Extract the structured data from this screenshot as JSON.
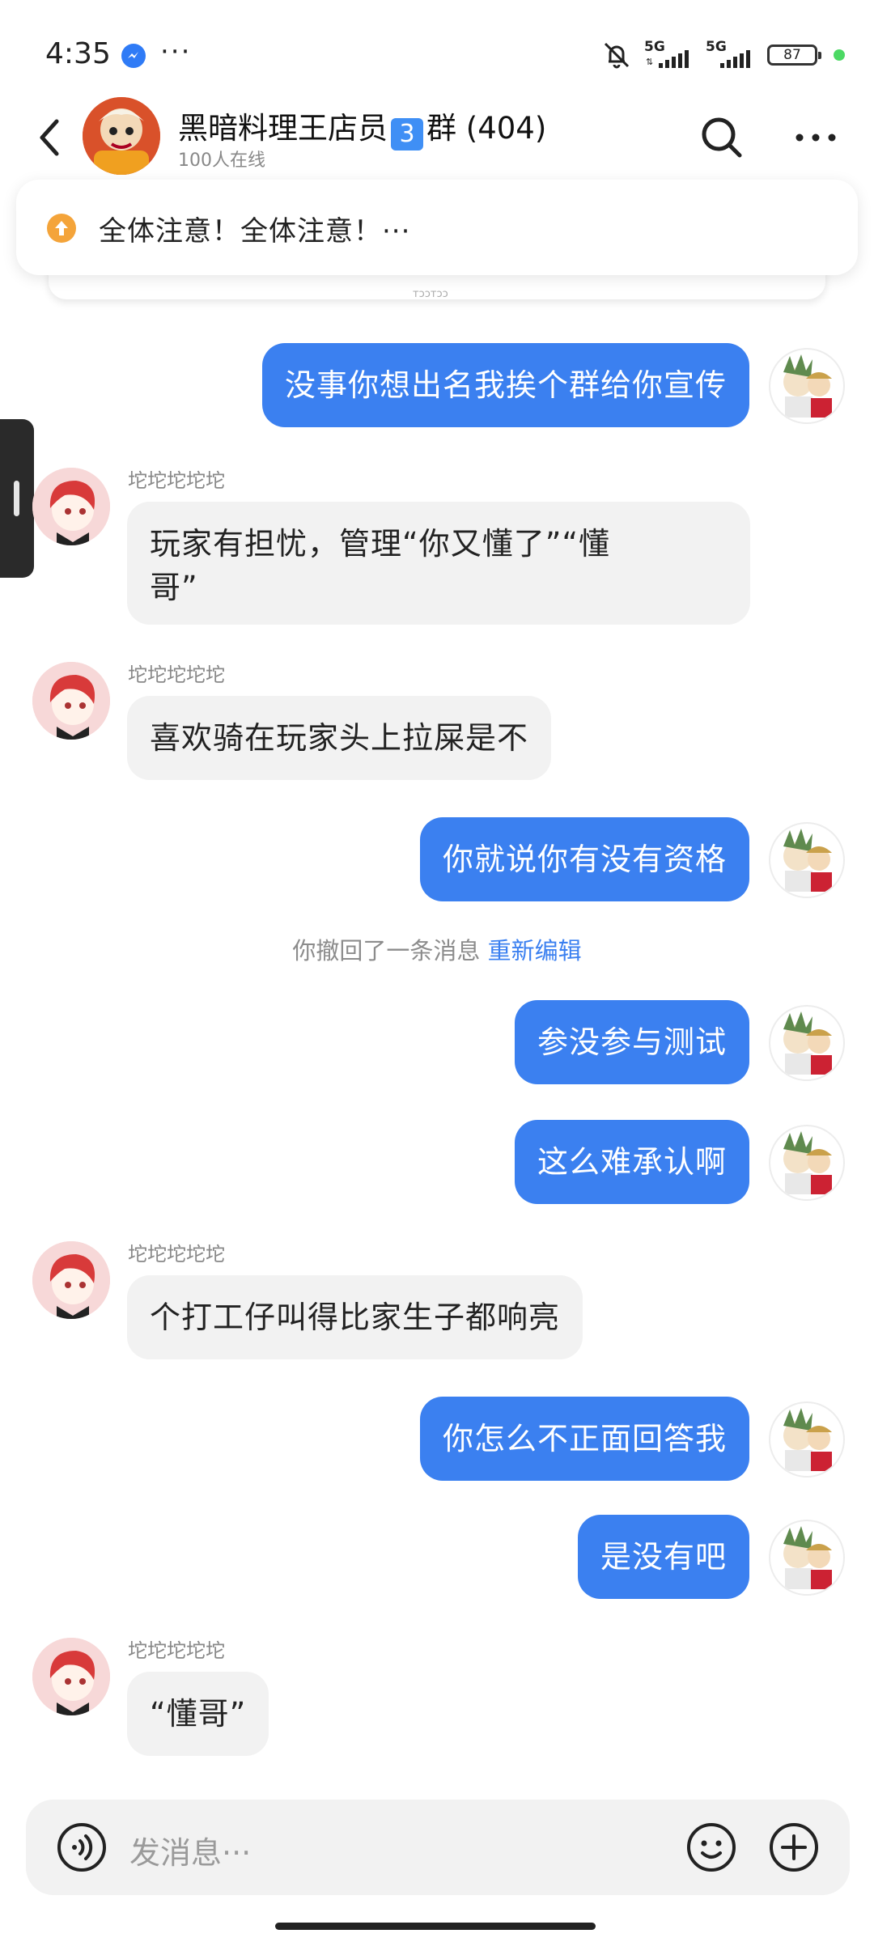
{
  "status_bar": {
    "time": "4:35",
    "more": "···",
    "net1": "5G",
    "net2": "5G",
    "battery": "87"
  },
  "header": {
    "title_prefix": "黑暗料理王店员",
    "title_badge": "3",
    "title_suffix": "群 (404)",
    "online": "100人在线"
  },
  "pinned": {
    "text": "全体注意！全体注意！···",
    "peek": "ᴛᴐᴐᴛᴐᴐ"
  },
  "messages": [
    {
      "side": "me",
      "text": "没事你想出名我挨个群给你宣传"
    },
    {
      "side": "other",
      "sender": "坨坨坨坨坨",
      "line1": "玩家有担忧，管理“你又懂了”“懂",
      "line2": "哥”"
    },
    {
      "side": "other",
      "sender": "坨坨坨坨坨",
      "text": "喜欢骑在玩家头上拉屎是不"
    },
    {
      "side": "me",
      "text": "你就说你有没有资格"
    },
    {
      "side": "system",
      "text": "你撤回了一条消息",
      "link": "重新编辑"
    },
    {
      "side": "me",
      "text": "参没参与测试"
    },
    {
      "side": "me",
      "text": "这么难承认啊"
    },
    {
      "side": "other",
      "sender": "坨坨坨坨坨",
      "text": "个打工仔叫得比家生子都响亮"
    },
    {
      "side": "me",
      "text": "你怎么不正面回答我"
    },
    {
      "side": "me",
      "text": "是没有吧"
    },
    {
      "side": "other",
      "sender": "坨坨坨坨坨",
      "text": "“懂哥”"
    }
  ],
  "input": {
    "placeholder": "发消息···"
  },
  "colors": {
    "accent": "#3b80f0",
    "bubble_other": "#f2f2f2",
    "pin_icon": "#f4a43a"
  }
}
